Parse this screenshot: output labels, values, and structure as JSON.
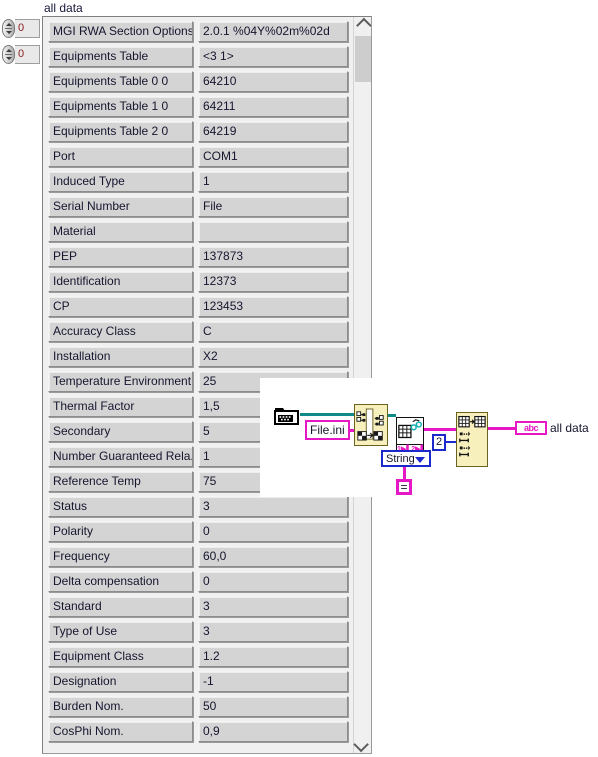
{
  "header": {
    "title": "all data"
  },
  "index_controls": [
    {
      "name": "array-index-row",
      "value": "0"
    },
    {
      "name": "array-index-col",
      "value": "0"
    }
  ],
  "array_table": {
    "rows": [
      {
        "key": "MGI RWA Section Options",
        "value": "2.0.1 %04Y%02m%02d"
      },
      {
        "key": "Equipments Table",
        "value": "<3 1>"
      },
      {
        "key": "Equipments Table 0 0",
        "value": "64210"
      },
      {
        "key": "Equipments Table 1 0",
        "value": "64211"
      },
      {
        "key": "Equipments Table 2 0",
        "value": "64219"
      },
      {
        "key": "Port",
        "value": "COM1"
      },
      {
        "key": "Induced Type",
        "value": "1"
      },
      {
        "key": "Serial Number",
        "value": "File"
      },
      {
        "key": "Material",
        "value": ""
      },
      {
        "key": "PEP",
        "value": "137873"
      },
      {
        "key": "Identification",
        "value": "12373"
      },
      {
        "key": "CP",
        "value": "123453"
      },
      {
        "key": "Accuracy Class",
        "value": "C"
      },
      {
        "key": "Installation",
        "value": "X2"
      },
      {
        "key": "Temperature Environment",
        "value": "25"
      },
      {
        "key": "Thermal Factor",
        "value": "1,5"
      },
      {
        "key": "Secondary",
        "value": "5"
      },
      {
        "key": "Number Guaranteed Rela.",
        "value": "1"
      },
      {
        "key": "Reference Temp",
        "value": "75"
      },
      {
        "key": "Status",
        "value": "3"
      },
      {
        "key": "Polarity",
        "value": "0"
      },
      {
        "key": "Frequency",
        "value": "60,0"
      },
      {
        "key": "Delta compensation",
        "value": "0"
      },
      {
        "key": "Standard",
        "value": "3"
      },
      {
        "key": "Type of Use",
        "value": "3"
      },
      {
        "key": "Equipment Class",
        "value": "1.2"
      },
      {
        "key": "Designation",
        "value": "-1"
      },
      {
        "key": "Burden Nom.",
        "value": "50"
      },
      {
        "key": "CosPhi Nom.",
        "value": "0,9"
      }
    ]
  },
  "scrollbar": {
    "up_icon": "chevron-up-icon",
    "down_icon": "chevron-down-icon"
  },
  "block_diagram": {
    "folder_icon": "folder-path-icon",
    "file_constant": "File.ini",
    "enum_value": "String",
    "equals_constant": "=",
    "numeric_constant": "2",
    "output_terminal": "abc",
    "output_label": "all data",
    "node_icons": [
      "build-path-vi-icon",
      "read-ini-file-vi-icon",
      "array-to-table-vi-icon"
    ],
    "colors": {
      "wire_path": "#0f8a8a",
      "wire_string": "#e617c4",
      "wire_numeric": "#1a28cc",
      "vi_background": "#f7f0bd"
    }
  }
}
